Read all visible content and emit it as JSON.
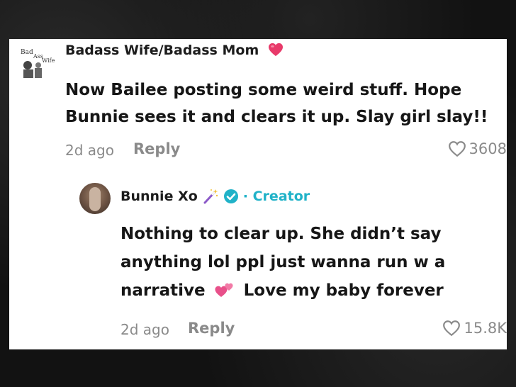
{
  "comment": {
    "author": "Badass Wife/Badass Mom",
    "text": "Now Bailee posting some weird stuff. Hope Bunnie sees it and clears it up. Slay girl slay!!",
    "time": "2d ago",
    "reply_label": "Reply",
    "likes": "3608"
  },
  "reply": {
    "author": "Bunnie Xo",
    "creator_label": "· Creator",
    "text_part1": "Nothing to clear up. She didn’t say anything lol ppl just wanna run w a narrative",
    "text_part2": "Love my baby forever",
    "time": "2d ago",
    "reply_label": "Reply",
    "likes": "15.8K"
  },
  "colors": {
    "creator": "#20b2c8",
    "heart": "#e83a6a",
    "muted": "#8a8a8a"
  },
  "icons": [
    "heart-emoji",
    "magic-wand-emoji",
    "verified-badge-icon",
    "like-heart-icon",
    "two-hearts-emoji"
  ]
}
